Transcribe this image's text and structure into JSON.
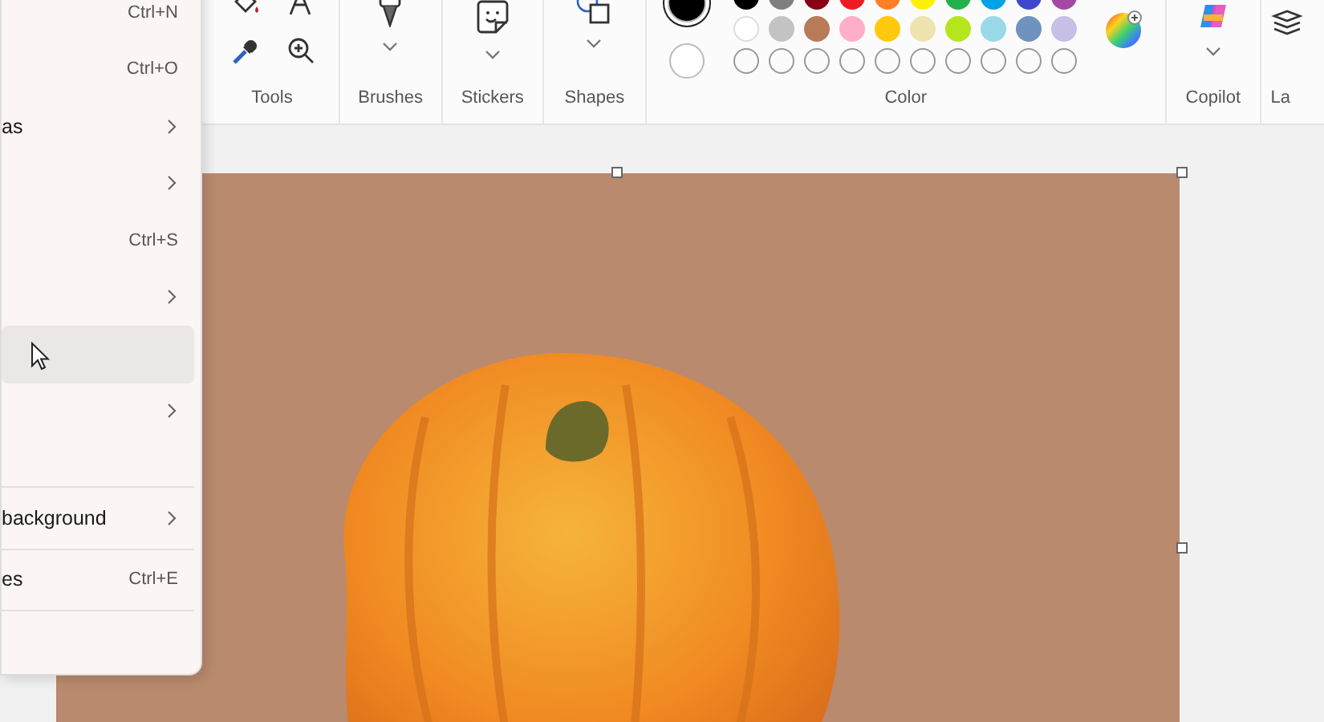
{
  "file_menu": {
    "sections": [
      [
        {
          "shortcut": "Ctrl+N",
          "submenu": false,
          "hovered": false
        },
        {
          "shortcut": "Ctrl+O",
          "submenu": false,
          "hovered": false
        },
        {
          "label": "as",
          "submenu": true,
          "hovered": false
        },
        {
          "submenu": true,
          "hovered": false
        },
        {
          "shortcut": "Ctrl+S",
          "submenu": false,
          "hovered": false
        },
        {
          "submenu": true,
          "hovered": false
        },
        {
          "submenu": false,
          "hovered": true
        },
        {
          "submenu": true,
          "hovered": false
        }
      ],
      [
        {
          "label": "background",
          "submenu": true,
          "hovered": false
        }
      ],
      [
        {
          "label": "es",
          "shortcut": "Ctrl+E",
          "submenu": false,
          "hovered": false
        }
      ]
    ]
  },
  "ribbon": {
    "groups": [
      {
        "kind": "tools",
        "label": "Tools"
      },
      {
        "kind": "brushes",
        "label": "Brushes"
      },
      {
        "kind": "stickers",
        "label": "Stickers"
      },
      {
        "kind": "shapes",
        "label": "Shapes"
      },
      {
        "kind": "color",
        "label": "Color",
        "primary": {
          "color": "#000000"
        },
        "secondary": {
          "color": "#ffffff"
        },
        "palette": [
          {
            "color": "#000000"
          },
          {
            "color": "#7f7f7f"
          },
          {
            "color": "#880015"
          },
          {
            "color": "#ed1c24"
          },
          {
            "color": "#ff7f27"
          },
          {
            "color": "#fff200"
          },
          {
            "color": "#22b14c"
          },
          {
            "color": "#00a2e8"
          },
          {
            "color": "#3f48cc"
          },
          {
            "color": "#a349a4"
          },
          {
            "color": "#ffffff"
          },
          {
            "color": "#c3c3c3"
          },
          {
            "color": "#b97a57"
          },
          {
            "color": "#ffaec9"
          },
          {
            "color": "#ffc90e"
          },
          {
            "color": "#efe4b0"
          },
          {
            "color": "#b5e61d"
          },
          {
            "color": "#99d9ea"
          },
          {
            "color": "#7092be"
          },
          {
            "color": "#c8bfe7"
          }
        ]
      },
      {
        "kind": "copilot",
        "label": "Copilot"
      },
      {
        "kind": "layers",
        "label": "La"
      }
    ]
  }
}
